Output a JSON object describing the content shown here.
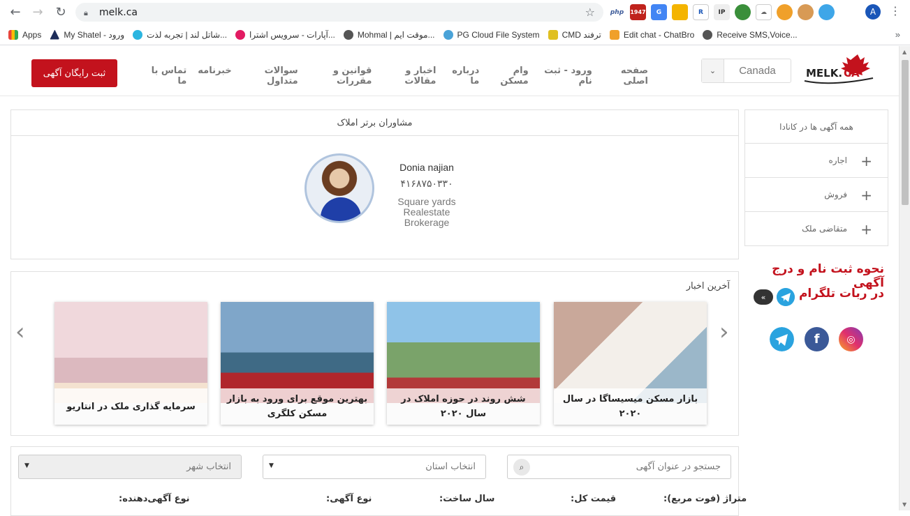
{
  "browser": {
    "url": "melk.ca",
    "profile_initial": "A",
    "extensions": [
      "php",
      "1947",
      "G",
      "",
      "R",
      "IP",
      "",
      "",
      "",
      "",
      ""
    ],
    "bookmarks": [
      {
        "label": "Apps",
        "color": "#e8453c"
      },
      {
        "label": "My Shatel - ورود",
        "color": "#1d2c5a"
      },
      {
        "label": "شاتل لند | تجربه لذت...",
        "color": "#2bb5e0"
      },
      {
        "label": "آپارات - سرویس اشترا...",
        "color": "#e21b62"
      },
      {
        "label": "Mohmal | موقت ایم...",
        "color": "#555555"
      },
      {
        "label": "PG Cloud File System",
        "color": "#4aa3d8"
      },
      {
        "label": "CMD ترفند",
        "color": "#e0c021"
      },
      {
        "label": "Edit chat - ChatBro",
        "color": "#f0a02a"
      },
      {
        "label": "Receive SMS,Voice...",
        "color": "#555555"
      }
    ]
  },
  "header": {
    "logo_text": "MELK.CA",
    "country": "Canada",
    "nav": [
      "صفحه اصلی",
      "ورود - ثبت نام",
      "وام مسکن",
      "درباره ما",
      "اخبار و مقالات",
      "قوانین و مقررات",
      "سوالات متداول",
      "خبرنامه",
      "تماس با ما"
    ],
    "cta": "ثبت رایگان آگهی"
  },
  "advisors": {
    "title": "مشاوران برتر املاک",
    "agent": {
      "name": "Donia najian",
      "phone": "۴۱۶۸۷۵۰۳۳۰",
      "company": "Square yards Realestate Brokerage"
    }
  },
  "sidebar": {
    "all_ads": "همه آگهی ها در کانادا",
    "items": [
      "اجاره",
      "فروش",
      "متقاضی ملک"
    ],
    "promo_line1": "نحوه ثبت نام و درج آگهی",
    "promo_line2": "در ربات تلگرام"
  },
  "news": {
    "title": "آخرین اخبار",
    "cards": [
      {
        "caption": "بازار مسکن میسیساگا در سال ۲۰۲۰"
      },
      {
        "caption": "شش روند در حوزه املاک در سال ۲۰۲۰"
      },
      {
        "caption": "بهترین موقع برای ورود به بازار مسکن کلگری"
      },
      {
        "caption": "سرمایه گذاری ملک در انتاریو"
      }
    ]
  },
  "search": {
    "title_placeholder": "جستجو در عنوان آگهی",
    "province_placeholder": "انتخاب استان",
    "city_placeholder": "انتخاب شهر",
    "labels": [
      "متراژ (فوت مربع):",
      "قیمت کل:",
      "سال ساخت:",
      "نوع آگهی:",
      "نوع آگهی‌دهنده:"
    ]
  },
  "colors": {
    "brand_red": "#c3121d",
    "telegram": "#2aa3df",
    "facebook": "#3b5998",
    "instagram": "#c13584"
  }
}
